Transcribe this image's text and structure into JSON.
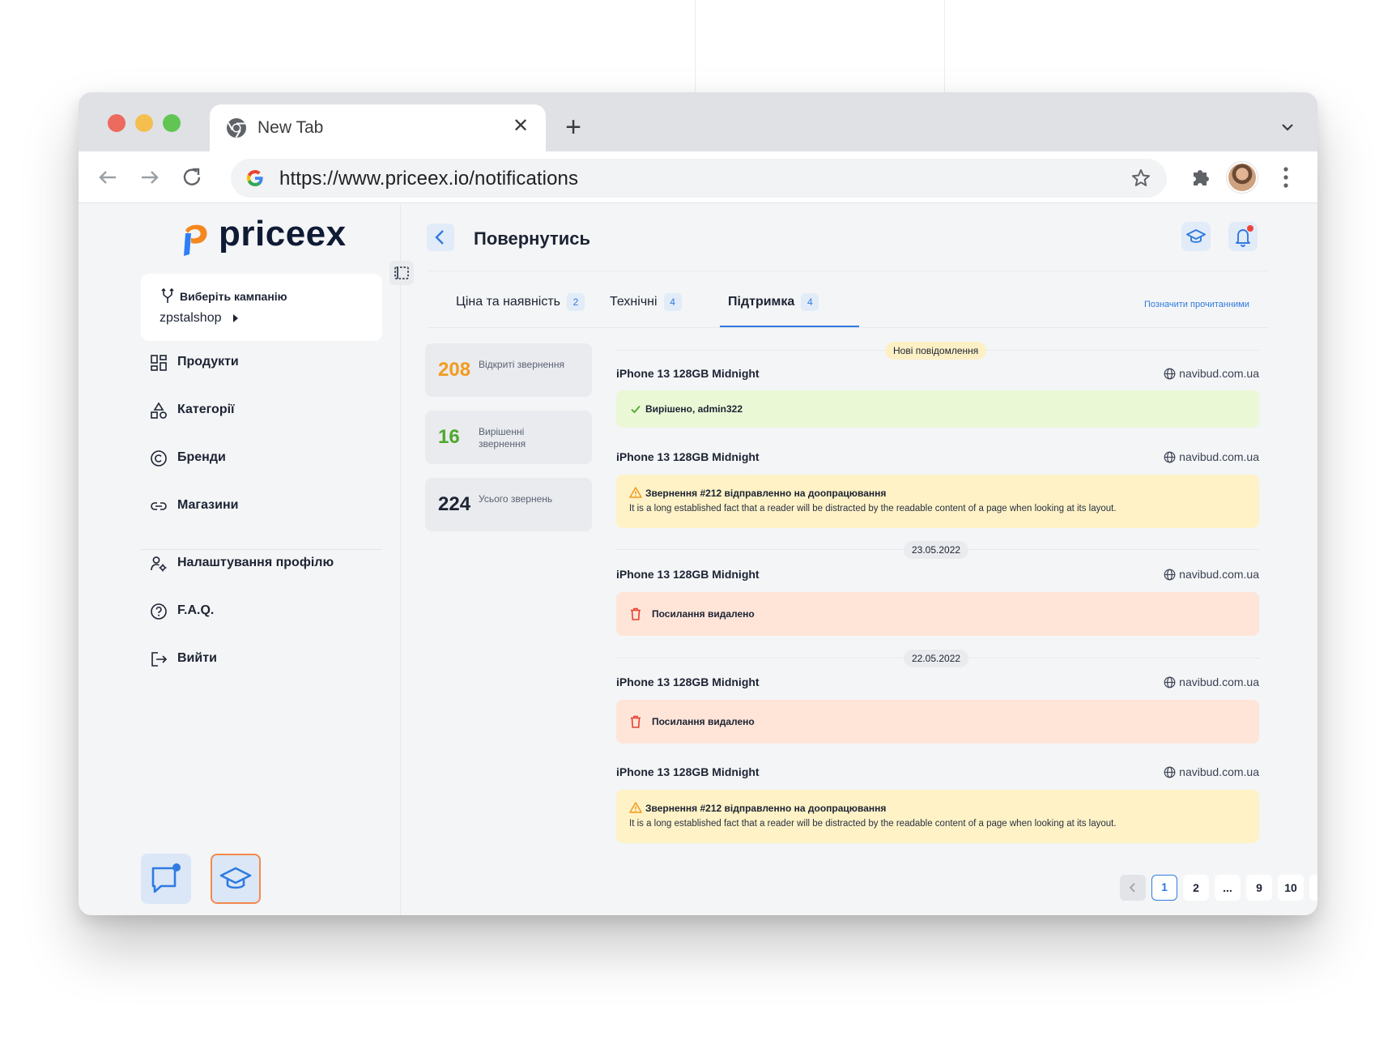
{
  "browser": {
    "tab_title": "New Tab",
    "url": "https://www.priceex.io/notifications"
  },
  "brand": {
    "name": "priceex",
    "colors": {
      "accent": "#2f7be0",
      "orange": "#f29b1f",
      "green": "#4fa72d",
      "logo_blue": "#2d7ff9",
      "logo_orange": "#f5871f"
    }
  },
  "sidebar": {
    "campaign_label": "Виберіть кампанію",
    "campaign_value": "zpstalshop",
    "items": [
      {
        "label": "Продукти",
        "icon": "grid-icon"
      },
      {
        "label": "Категорії",
        "icon": "shapes-icon"
      },
      {
        "label": "Бренди",
        "icon": "copyright-icon"
      },
      {
        "label": "Магазини",
        "icon": "link-icon"
      }
    ],
    "items2": [
      {
        "label": "Налаштування профілю",
        "icon": "user-settings-icon"
      },
      {
        "label": "F.A.Q.",
        "icon": "help-icon"
      },
      {
        "label": "Вийти",
        "icon": "logout-icon"
      }
    ]
  },
  "header": {
    "back_label": "Повернутись"
  },
  "tabs": [
    {
      "label": "Ціна та наявність",
      "count": "2"
    },
    {
      "label": "Технічні",
      "count": "4"
    },
    {
      "label": "Підтримка",
      "count": "4"
    }
  ],
  "mark_read": "Позначити прочитанними",
  "stats": [
    {
      "value": "208",
      "label": "Відкриті звернення",
      "color": "#f29b1f"
    },
    {
      "value": "16",
      "label": "Вирішенні звернення",
      "color": "#4fa72d"
    },
    {
      "value": "224",
      "label": "Усього звернень",
      "color": "#1c2333"
    }
  ],
  "feed": {
    "new_label": "Нові повідомлення",
    "dates": [
      "23.05.2022",
      "22.05.2022"
    ],
    "notifications": [
      {
        "product": "iPhone 13 128GB Midnight",
        "shop": "navibud.com.ua",
        "type": "resolved",
        "title": "Вирішено, admin322",
        "desc": ""
      },
      {
        "product": "iPhone 13 128GB Midnight",
        "shop": "navibud.com.ua",
        "type": "warning",
        "title": "Звернення #212 відправленно на доопрацювання",
        "desc": "It is a long established fact that a reader will be distracted by the readable content of a page when looking at its layout."
      },
      {
        "product": "iPhone 13 128GB Midnight",
        "shop": "navibud.com.ua",
        "type": "deleted",
        "title": "Посилання видалено",
        "desc": ""
      },
      {
        "product": "iPhone 13 128GB Midnight",
        "shop": "navibud.com.ua",
        "type": "deleted",
        "title": "Посилання видалено",
        "desc": ""
      },
      {
        "product": "iPhone 13 128GB Midnight",
        "shop": "navibud.com.ua",
        "type": "warning",
        "title": "Звернення #212 відправленно на доопрацювання",
        "desc": "It is a long established fact that a reader will be distracted by the readable content of a page when looking at its layout."
      }
    ]
  },
  "pagination": {
    "pages": [
      "1",
      "2",
      "...",
      "9",
      "10"
    ],
    "current": "1"
  }
}
